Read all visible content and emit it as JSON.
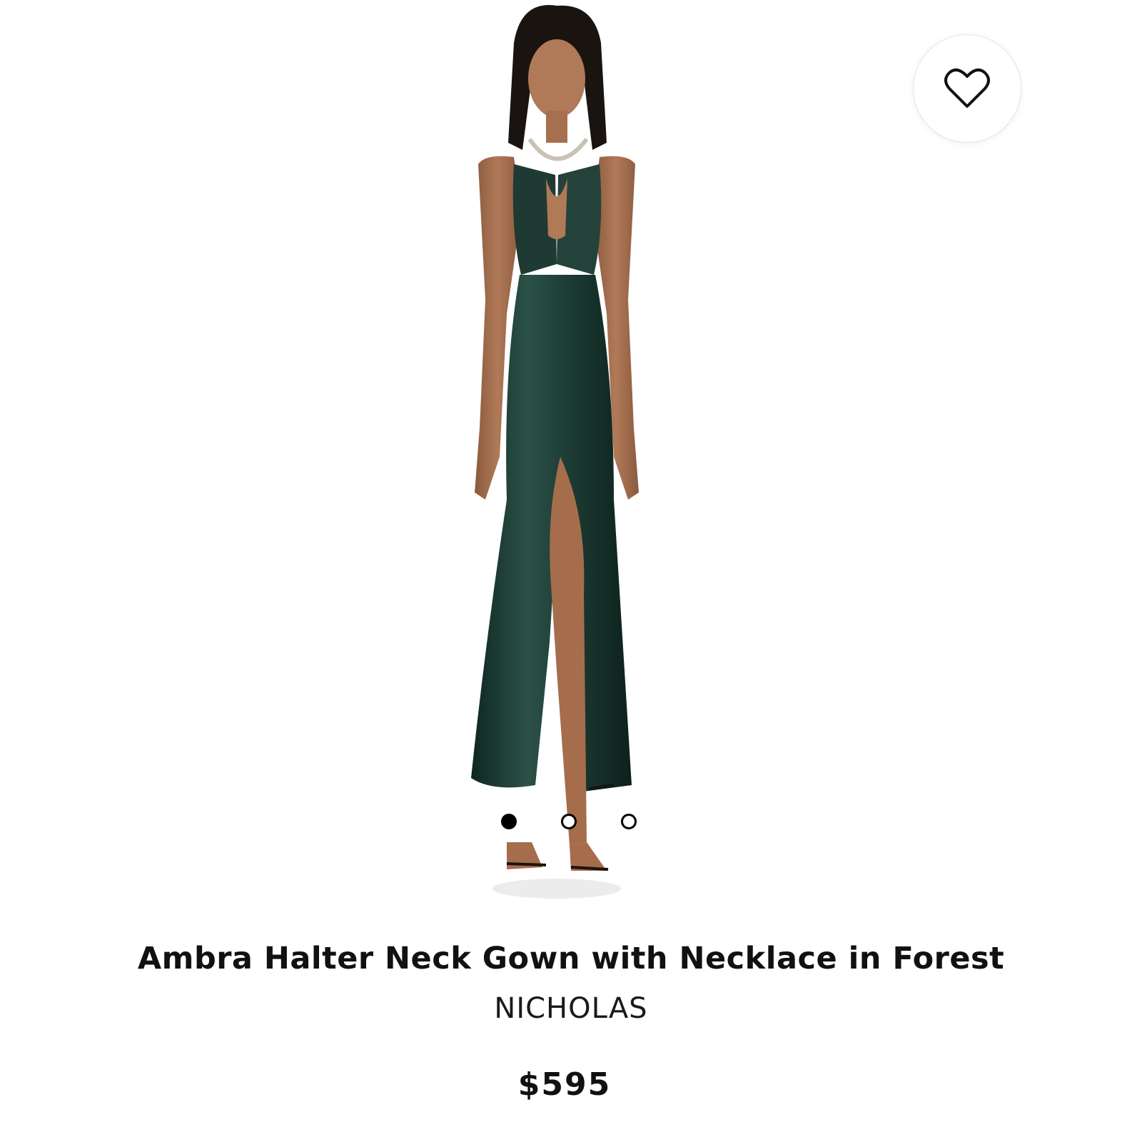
{
  "product": {
    "title": "Ambra Halter Neck Gown with Necklace in Forest",
    "brand": "NICHOLAS",
    "price": "$595"
  },
  "gallery": {
    "image_alt": "Model wearing dark green satin halter neck gown with chain necklace",
    "slide_count": 3,
    "active_slide": 1,
    "dress_color": "#1f3a33"
  },
  "wishlist": {
    "icon": "heart-outline-icon"
  }
}
